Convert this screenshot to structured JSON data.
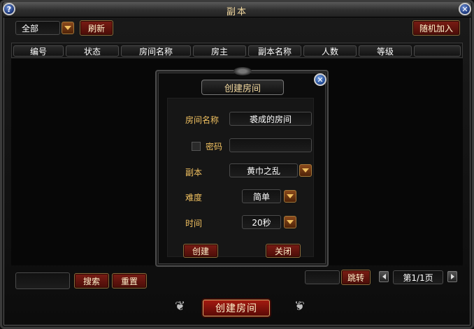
{
  "window": {
    "title": "副本"
  },
  "toolbar": {
    "filter_value": "全部",
    "refresh_label": "刷新",
    "random_join_label": "随机加入"
  },
  "table": {
    "columns": [
      "编号",
      "状态",
      "房间名称",
      "房主",
      "副本名称",
      "人数",
      "等级",
      ""
    ],
    "rows": []
  },
  "dialog": {
    "title": "创建房间",
    "room_name_label": "房间名称",
    "room_name_value": "裘成的房间",
    "password_label": "密码",
    "password_value": "",
    "dungeon_label": "副本",
    "dungeon_value": "黄巾之乱",
    "difficulty_label": "难度",
    "difficulty_value": "简单",
    "time_label": "时间",
    "time_value": "20秒",
    "create_label": "创建",
    "close_label": "关闭"
  },
  "bottom": {
    "search_value": "",
    "search_label": "搜索",
    "reset_label": "重置",
    "jump_value": "",
    "jump_label": "跳转",
    "page_indicator": "第1/1页",
    "create_room_label": "创建房间"
  },
  "icons": {
    "help": "help-icon",
    "close": "close-icon",
    "dropdown": "chevron-down-icon",
    "prev": "arrow-left-icon",
    "next": "arrow-right-icon"
  },
  "colors": {
    "gold_text": "#f0c060",
    "title_text": "#f3d9a0",
    "button_red": "#7a1c14"
  }
}
